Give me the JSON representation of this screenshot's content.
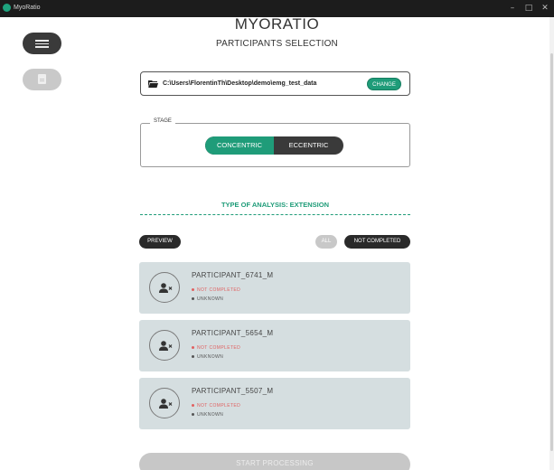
{
  "window": {
    "title": "MyoRatio",
    "controls": [
      "–",
      "□",
      "✕"
    ]
  },
  "sidebar": {
    "menu_icon": "menu-icon",
    "doc_icon": "document-icon"
  },
  "header": {
    "app_title": "MYORATIO",
    "page_title": "PARTICIPANTS SELECTION"
  },
  "folder": {
    "icon": "folder-icon",
    "path": "C:\\Users\\FlorentinTh\\Desktop\\demo\\emg_test_data",
    "change_label": "CHANGE"
  },
  "stage": {
    "legend": "STAGE",
    "options": [
      "CONCENTRIC",
      "ECCENTRIC"
    ],
    "selected": "CONCENTRIC"
  },
  "analysis": {
    "label": "TYPE OF ANALYSIS: EXTENSION"
  },
  "filters": {
    "preview_label": "PREVIEW",
    "all_label": "ALL",
    "not_completed_label": "NOT COMPLETED"
  },
  "participants": [
    {
      "name": "PARTICIPANT_6741_M",
      "status": "NOT COMPLETED",
      "result": "UNKNOWN"
    },
    {
      "name": "PARTICIPANT_5654_M",
      "status": "NOT COMPLETED",
      "result": "UNKNOWN"
    },
    {
      "name": "PARTICIPANT_5507_M",
      "status": "NOT COMPLETED",
      "result": "UNKNOWN"
    }
  ],
  "actions": {
    "start_label": "START PROCESSING"
  },
  "colors": {
    "accent": "#1f9c79",
    "dark": "#2a2a2a",
    "card": "#d5dee0",
    "error": "#e06060"
  }
}
